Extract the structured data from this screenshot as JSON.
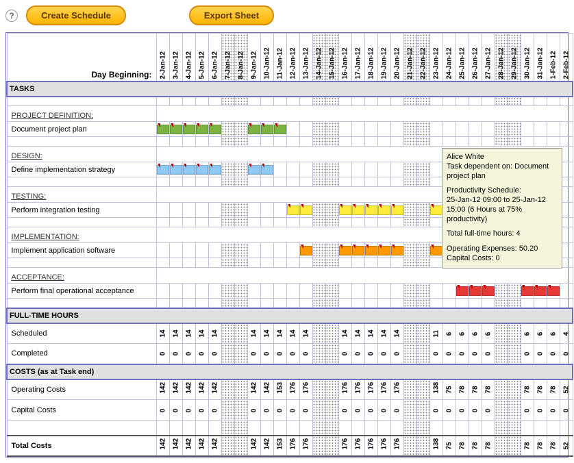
{
  "toolbar": {
    "help_label": "?",
    "create_label": "Create Schedule",
    "export_label": "Export Sheet"
  },
  "header": {
    "day_beginning_label": "Day Beginning:"
  },
  "dates": [
    "2-Jan-12",
    "3-Jan-12",
    "4-Jan-12",
    "5-Jan-12",
    "6-Jan-12",
    "7-Jan-12",
    "8-Jan-12",
    "9-Jan-12",
    "10-Jan-12",
    "11-Jan-12",
    "12-Jan-12",
    "13-Jan-12",
    "14-Jan-12",
    "15-Jan-12",
    "16-Jan-12",
    "17-Jan-12",
    "18-Jan-12",
    "19-Jan-12",
    "20-Jan-12",
    "21-Jan-12",
    "22-Jan-12",
    "23-Jan-12",
    "24-Jan-12",
    "25-Jan-12",
    "26-Jan-12",
    "27-Jan-12",
    "28-Jan-12",
    "29-Jan-12",
    "30-Jan-12",
    "31-Jan-12",
    "1-Feb-12",
    "2-Feb-12"
  ],
  "weekends": [
    5,
    6,
    12,
    13,
    19,
    20,
    26,
    27
  ],
  "sections": {
    "tasks_label": "TASKS",
    "project_def": "PROJECT DEFINITION:",
    "doc_plan": "Document project plan",
    "design": "DESIGN:",
    "define_impl": "Define implementation strategy",
    "testing": "TESTING:",
    "perf_int": "Perform integration testing",
    "implementation": "IMPLEMENTATION:",
    "impl_sw": "Implement application software",
    "acceptance": "ACCEPTANCE:",
    "perf_final": "Perform final operational acceptance",
    "fth_label": "FULL-TIME HOURS",
    "scheduled": "Scheduled",
    "completed": "Completed",
    "costs_label": "COSTS (as at Task end)",
    "op_costs": "Operating Costs",
    "cap_costs": "Capital Costs",
    "total_costs": "Total Costs"
  },
  "chart_data": {
    "type": "bar",
    "title": "Gantt Schedule",
    "x": [
      "2-Jan-12",
      "3-Jan-12",
      "4-Jan-12",
      "5-Jan-12",
      "6-Jan-12",
      "7-Jan-12",
      "8-Jan-12",
      "9-Jan-12",
      "10-Jan-12",
      "11-Jan-12",
      "12-Jan-12",
      "13-Jan-12",
      "14-Jan-12",
      "15-Jan-12",
      "16-Jan-12",
      "17-Jan-12",
      "18-Jan-12",
      "19-Jan-12",
      "20-Jan-12",
      "21-Jan-12",
      "22-Jan-12",
      "23-Jan-12",
      "24-Jan-12",
      "25-Jan-12",
      "26-Jan-12",
      "27-Jan-12",
      "28-Jan-12",
      "29-Jan-12",
      "30-Jan-12",
      "31-Jan-12",
      "1-Feb-12",
      "2-Feb-12"
    ],
    "series": [
      {
        "name": "Document project plan",
        "color": "#7cb342",
        "bars": [
          [
            0,
            4
          ],
          [
            7,
            9
          ]
        ]
      },
      {
        "name": "Define implementation strategy",
        "color": "#90caf9",
        "bars": [
          [
            0,
            4
          ],
          [
            7,
            8
          ]
        ]
      },
      {
        "name": "Perform integration testing",
        "color": "#ffeb3b",
        "bars": [
          [
            10,
            11
          ],
          [
            14,
            18
          ],
          [
            21,
            24
          ]
        ]
      },
      {
        "name": "Implement application software",
        "color": "#ff9800",
        "bars": [
          [
            11,
            11
          ],
          [
            14,
            18
          ],
          [
            21,
            21
          ]
        ]
      },
      {
        "name": "Perform final operational acceptance",
        "color": "#e53935",
        "bars": [
          [
            23,
            25
          ],
          [
            28,
            30
          ]
        ]
      }
    ]
  },
  "hours": {
    "scheduled": [
      14,
      14,
      14,
      14,
      14,
      "",
      "",
      14,
      14,
      14,
      14,
      14,
      "",
      "",
      14,
      14,
      14,
      14,
      14,
      "",
      "",
      11,
      6,
      6,
      6,
      6,
      "",
      "",
      6,
      6,
      6,
      4
    ],
    "completed": [
      0,
      0,
      0,
      0,
      0,
      "",
      "",
      0,
      0,
      0,
      0,
      0,
      "",
      "",
      0,
      0,
      0,
      0,
      0,
      "",
      "",
      0,
      0,
      0,
      0,
      0,
      "",
      "",
      0,
      0,
      0,
      0
    ]
  },
  "costs": {
    "operating": [
      142,
      142,
      142,
      142,
      142,
      "",
      "",
      142,
      142,
      153,
      176,
      176,
      "",
      "",
      176,
      176,
      176,
      176,
      176,
      "",
      "",
      138,
      75,
      78,
      78,
      78,
      "",
      "",
      78,
      78,
      78,
      52
    ],
    "capital": [
      0,
      0,
      0,
      0,
      0,
      "",
      "",
      0,
      0,
      0,
      0,
      0,
      "",
      "",
      0,
      0,
      0,
      0,
      0,
      "",
      "",
      0,
      0,
      0,
      0,
      0,
      "",
      "",
      0,
      0,
      0,
      0
    ],
    "total": [
      142,
      142,
      142,
      142,
      142,
      "",
      "",
      142,
      142,
      153,
      176,
      176,
      "",
      "",
      176,
      176,
      176,
      176,
      176,
      "",
      "",
      138,
      75,
      78,
      78,
      78,
      "",
      "",
      78,
      78,
      78,
      52
    ]
  },
  "tooltip": {
    "line1": "Alice White",
    "line2": "Task dependent on: Document project plan",
    "line3": "Productivity Schedule:",
    "line4": "25-Jan-12 09:00 to 25-Jan-12 15:00 (6 Hours at 75% productivity)",
    "line5": "Total full-time hours: 4",
    "line6": "Operating Expenses: 50.20",
    "line7": "Capital Costs: 0"
  }
}
